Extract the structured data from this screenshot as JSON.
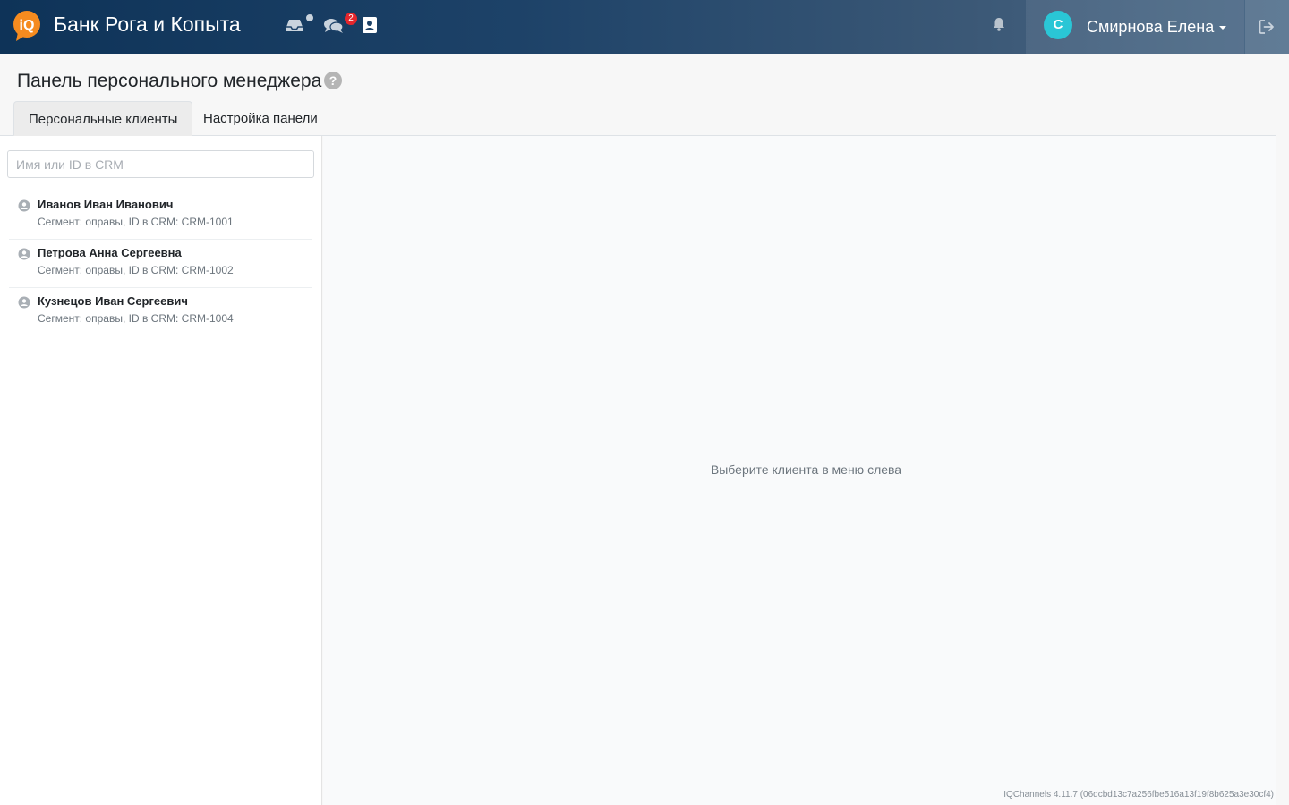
{
  "header": {
    "brand": "Банк Рога и Копыта",
    "logo_text": "iQ",
    "chats_badge": "2",
    "user_initial": "С",
    "user_name": "Смирнова Елена",
    "colors": {
      "accent": "#f58b1f",
      "avatar": "#2ac6d6",
      "badge": "#e4262c"
    },
    "icons": [
      "inbox-icon",
      "chats-icon",
      "contacts-icon",
      "bell-icon",
      "logout-icon"
    ]
  },
  "page": {
    "title": "Панель персонального менеджера",
    "help": "?"
  },
  "tabs": [
    {
      "label": "Персональные клиенты",
      "active": true
    },
    {
      "label": "Настройка панели",
      "active": false
    }
  ],
  "sidebar": {
    "search_placeholder": "Имя или ID в CRM",
    "clients": [
      {
        "name": "Иванов Иван Иванович",
        "meta": "Сегмент: оправы, ID в CRM: CRM-1001"
      },
      {
        "name": "Петрова Анна Сергеевна",
        "meta": "Сегмент: оправы, ID в CRM: CRM-1002"
      },
      {
        "name": "Кузнецов Иван Сергеевич",
        "meta": "Сегмент: оправы, ID в CRM: CRM-1004"
      }
    ]
  },
  "main": {
    "empty_message": "Выберите клиента в меню слева",
    "version": "IQChannels 4.11.7 (06dcbd13c7a256fbe516a13f19f8b625a3e30cf4)"
  }
}
